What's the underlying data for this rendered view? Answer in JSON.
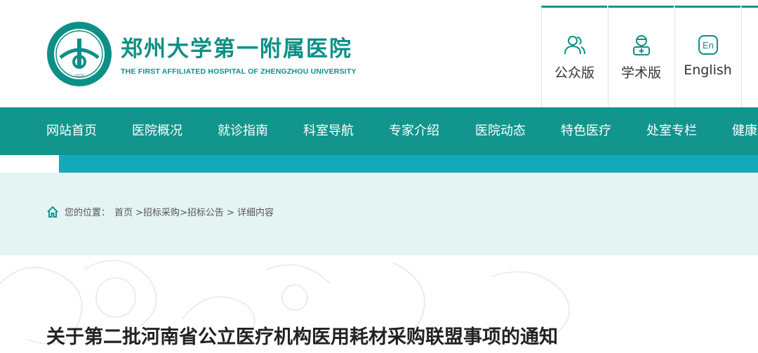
{
  "header": {
    "logo_cn": "郑州大学第一附属医院",
    "logo_en": "THE FIRST AFFILIATED HOSPITAL OF ZHENGZHOU UNIVERSITY",
    "seal_text": "郑州大学第一附属医院 THE FIRST AFFILIATED HOSPITAL OF ZHENGZHOU UNIVERSITY",
    "seal_year": "1928",
    "brand_color": "#12958c",
    "versions": [
      {
        "label": "公众版",
        "icon": "people-icon"
      },
      {
        "label": "学术版",
        "icon": "doctor-icon"
      },
      {
        "label": "English",
        "icon": "en-icon"
      }
    ]
  },
  "nav": {
    "items": [
      "网站首页",
      "医院概况",
      "就诊指南",
      "科室导航",
      "专家介绍",
      "医院动态",
      "特色医疗",
      "处室专栏",
      "健康"
    ]
  },
  "breadcrumb": {
    "prefix": "您的位置：",
    "items": [
      "首页",
      ">招标采购",
      ">招标公告",
      " > 详细内容"
    ]
  },
  "article": {
    "title": "关于第二批河南省公立医疗机构医用耗材采购联盟事项的通知"
  }
}
